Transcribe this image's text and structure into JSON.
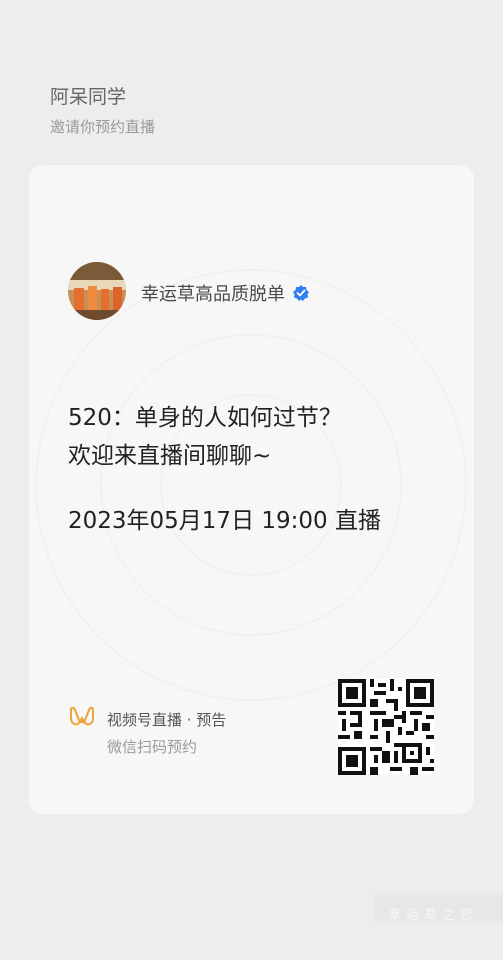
{
  "header": {
    "inviter": "阿呆同学",
    "subtitle": "邀请你预约直播"
  },
  "card": {
    "account_name": "幸运草高品质脱单",
    "verified_icon": "verified-badge-icon",
    "live_title_line1": "520：单身的人如何过节？",
    "live_title_line2": "欢迎来直播间聊聊~",
    "live_time": "2023年05月17日 19:00 直播",
    "brand_label": "视频号直播 · 预告",
    "scan_hint": "微信扫码预约",
    "brand_icon": "channels-logo-icon",
    "qr_icon": "qr-code"
  },
  "watermark": {
    "pinyin": "xing yun cao zhi lian",
    "text": "幸运草之恋"
  },
  "colors": {
    "background": "#ededed",
    "card": "#f7f7f7",
    "verified": "#2f7ff0",
    "brand_orange": "#f0a23b"
  }
}
